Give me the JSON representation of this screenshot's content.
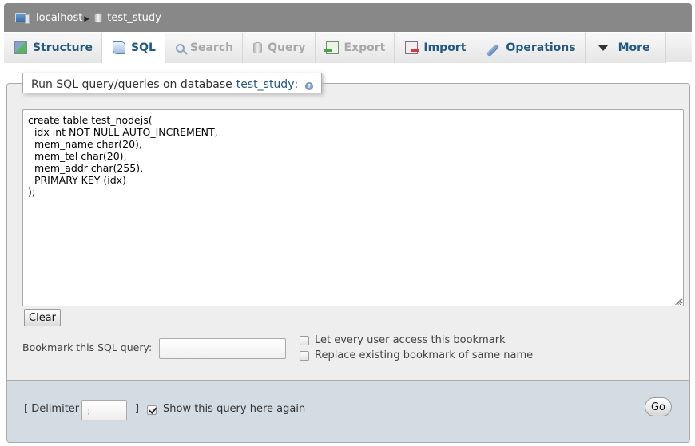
{
  "breadcrumb": {
    "items": [
      {
        "label": "localhost",
        "icon": "server-icon"
      },
      {
        "label": "test_study",
        "icon": "database-icon"
      }
    ]
  },
  "tabs": [
    {
      "label": "Structure",
      "icon": "structure-icon",
      "state": "normal"
    },
    {
      "label": "SQL",
      "icon": "sql-icon",
      "state": "active"
    },
    {
      "label": "Search",
      "icon": "search-icon",
      "state": "disabled"
    },
    {
      "label": "Query",
      "icon": "query-icon",
      "state": "disabled"
    },
    {
      "label": "Export",
      "icon": "export-icon",
      "state": "disabled"
    },
    {
      "label": "Import",
      "icon": "import-icon",
      "state": "normal"
    },
    {
      "label": "Operations",
      "icon": "operations-icon",
      "state": "normal"
    },
    {
      "label": "More",
      "icon": "triangle-down-icon",
      "state": "normal"
    }
  ],
  "sql_panel": {
    "legend_prefix": "Run SQL query/queries on database",
    "database": "test_study",
    "legend_suffix": ":",
    "help_icon": "help-icon",
    "query": "create table test_nodejs(\n  idx int NOT NULL AUTO_INCREMENT,\n  mem_name char(20),\n  mem_tel char(20),\n  mem_addr char(255),\n  PRIMARY KEY (idx)\n);",
    "clear_label": "Clear",
    "bookmark_label": "Bookmark this SQL query:",
    "bookmark_value": "",
    "options": [
      {
        "label": "Let every user access this bookmark",
        "checked": false
      },
      {
        "label": "Replace existing bookmark of same name",
        "checked": false
      }
    ]
  },
  "footer": {
    "delimiter_open": "[ Delimiter",
    "delimiter_value": ";",
    "delimiter_close": "]",
    "show_again_label": "Show this query here again",
    "show_again_checked": true,
    "go_label": "Go"
  }
}
